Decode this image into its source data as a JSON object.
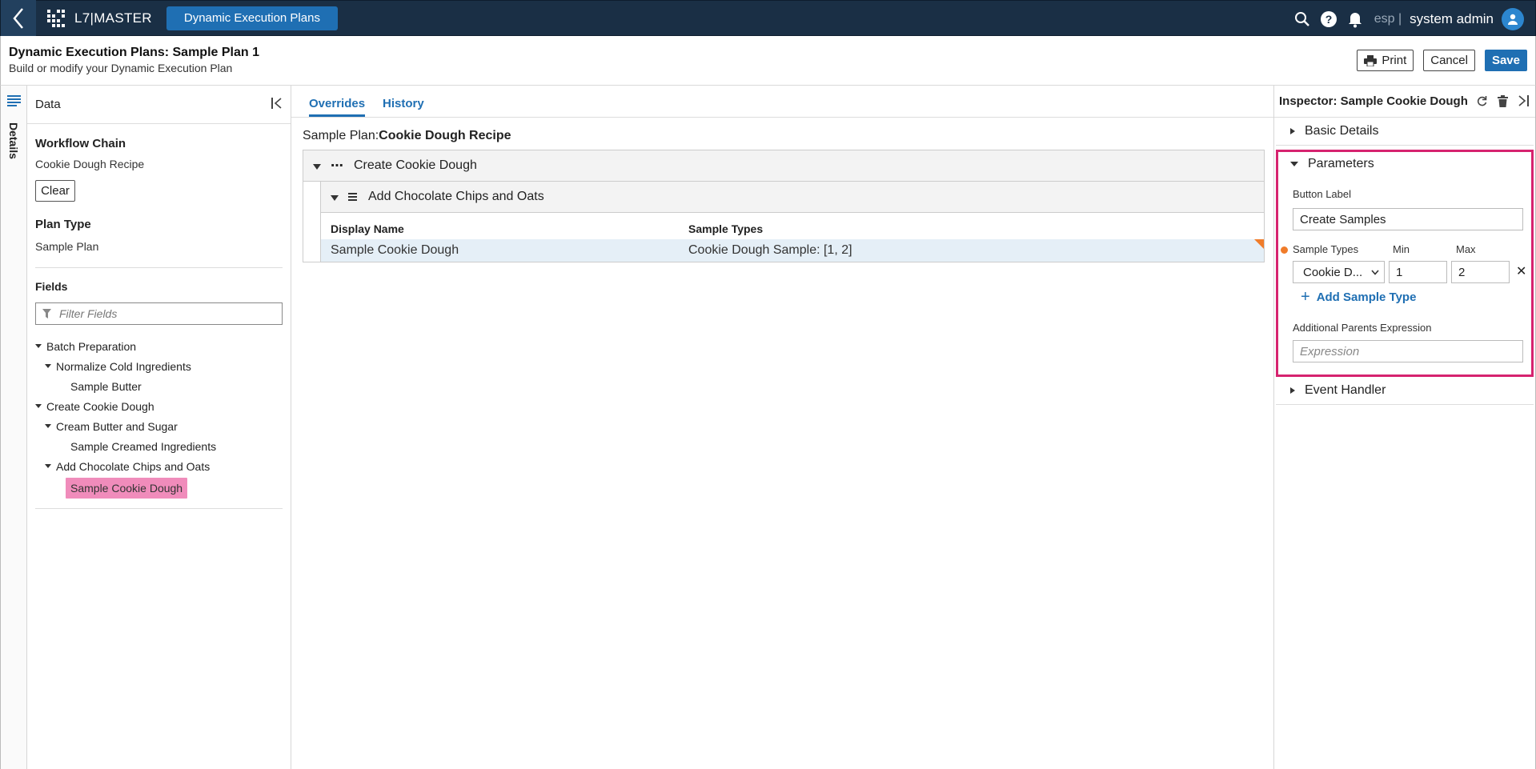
{
  "topbar": {
    "app_name": "L7|MASTER",
    "active_app": "Dynamic Execution Plans",
    "lang": "esp |",
    "user": "system admin"
  },
  "header": {
    "title": "Dynamic Execution Plans: Sample Plan 1",
    "subtitle": "Build or modify your Dynamic Execution Plan",
    "print_label": "Print",
    "cancel_label": "Cancel",
    "save_label": "Save"
  },
  "rail": {
    "label": "Details"
  },
  "data_panel": {
    "title": "Data",
    "workflow_chain_label": "Workflow Chain",
    "workflow_chain_value": "Cookie Dough Recipe",
    "clear_label": "Clear",
    "plan_type_label": "Plan Type",
    "plan_type_value": "Sample Plan",
    "fields_label": "Fields",
    "filter_placeholder": "Filter Fields",
    "tree": [
      {
        "label": "Batch Preparation",
        "level": 0,
        "expanded": true
      },
      {
        "label": "Normalize Cold Ingredients",
        "level": 1,
        "expanded": true
      },
      {
        "label": "Sample Butter",
        "level": 2
      },
      {
        "label": "Create Cookie Dough",
        "level": 0,
        "expanded": true
      },
      {
        "label": "Cream Butter and Sugar",
        "level": 1,
        "expanded": true
      },
      {
        "label": "Sample Creamed Ingredients",
        "level": 2
      },
      {
        "label": "Add Chocolate Chips and Oats",
        "level": 1,
        "expanded": true
      },
      {
        "label": "Sample Cookie Dough",
        "level": 2,
        "selected": true
      }
    ]
  },
  "center": {
    "tabs": [
      "Overrides",
      "History"
    ],
    "active_tab": "Overrides",
    "plan_prefix": "Sample Plan:",
    "plan_name": "Cookie Dough Recipe",
    "group_title": "Create Cookie Dough",
    "subgroup_title": "Add Chocolate Chips and Oats",
    "columns": [
      "Display Name",
      "Sample Types"
    ],
    "rows": [
      {
        "display_name": "Sample Cookie Dough",
        "sample_types": "Cookie Dough Sample: [1, 2]"
      }
    ]
  },
  "inspector": {
    "title": "Inspector: Sample Cookie Dough",
    "sections": {
      "basic": "Basic Details",
      "params": "Parameters",
      "event": "Event Handler"
    },
    "button_label_label": "Button Label",
    "button_label_value": "Create Samples",
    "sample_types_label": "Sample Types",
    "min_label": "Min",
    "max_label": "Max",
    "sample_type_selected": "Cookie D...",
    "min_value": "1",
    "max_value": "2",
    "add_sample_type": "Add Sample Type",
    "additional_parents_label": "Additional Parents Expression",
    "expression_placeholder": "Expression"
  },
  "colors": {
    "topbar": "#1a2f45",
    "accent": "#1f6fb3",
    "highlight": "#d6236f",
    "selected_tree": "#f08cbb",
    "flag": "#f07c2a"
  }
}
